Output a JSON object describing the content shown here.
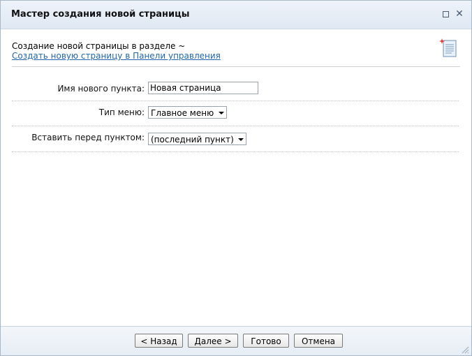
{
  "window": {
    "title": "Мастер создания новой страницы"
  },
  "header": {
    "section_text": "Создание новой страницы в разделе ~",
    "control_panel_link": "Создать новую страницу в Панели управления"
  },
  "form": {
    "item_name_label": "Имя нового пункта:",
    "item_name_value": "Новая страница",
    "menu_type_label": "Тип меню:",
    "menu_type_value": "Главное меню",
    "insert_before_label": "Вставить перед пунктом:",
    "insert_before_value": "(последний пункт)"
  },
  "footer": {
    "back_label": "< Назад",
    "next_label": "Далее >",
    "done_label": "Готово",
    "cancel_label": "Отмена"
  },
  "icons": {
    "maximize": "maximize-icon",
    "close": "close-icon",
    "new_page": "new-page-icon",
    "resize": "resize-grip-icon"
  },
  "colors": {
    "link": "#2067b0",
    "titlebar": "#dfe8f3",
    "border": "#a9b8c9"
  }
}
